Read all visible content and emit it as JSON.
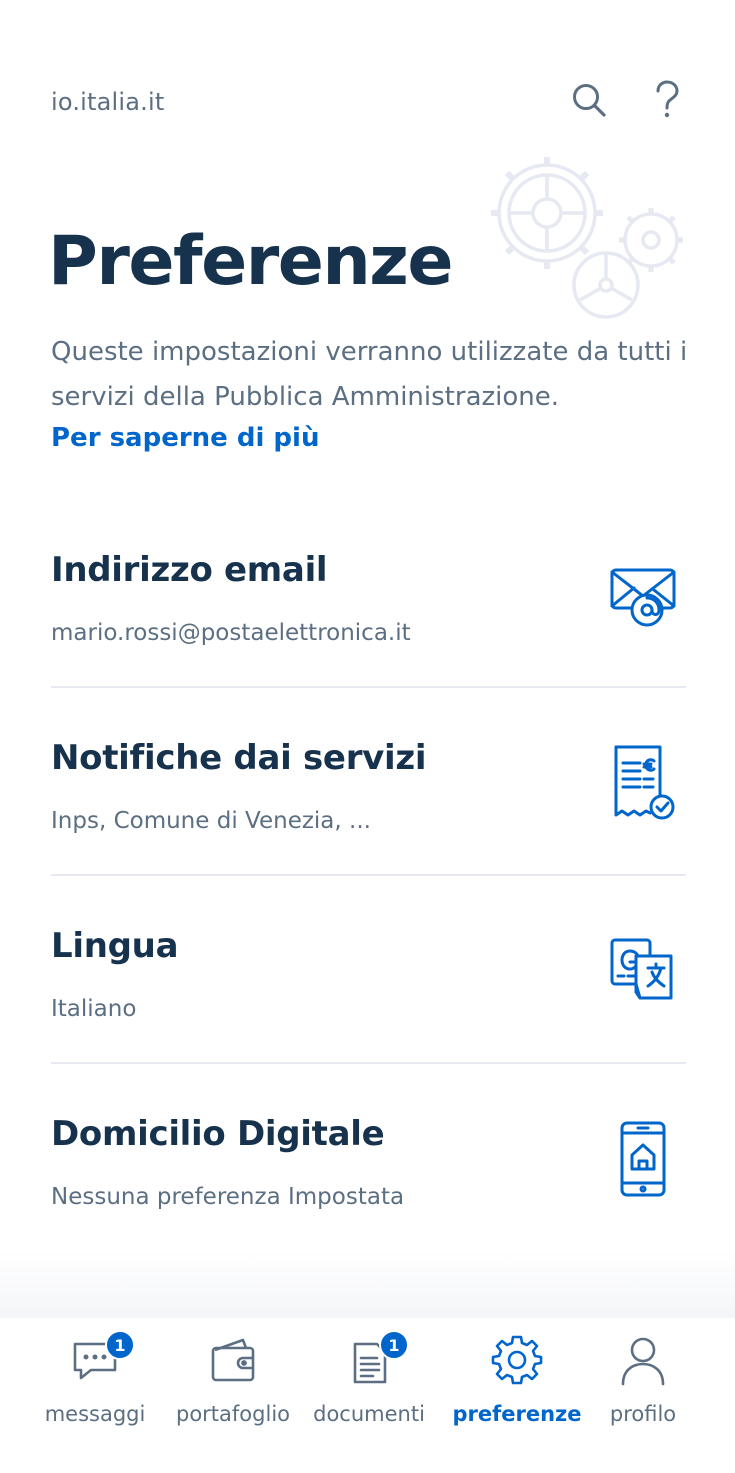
{
  "header": {
    "brand": "io.italia.it",
    "search_icon": "search-icon",
    "help_icon": "help-icon"
  },
  "page": {
    "title": "Preferenze",
    "subtitle": "Queste impostazioni verranno utilizzate da tutti i servizi della Pubblica Amministrazione.",
    "learn_more": "Per saperne di più"
  },
  "preferences": [
    {
      "title": "Indirizzo email",
      "value": "mario.rossi@postaelettronica.it",
      "icon": "email-icon"
    },
    {
      "title": "Notifiche dai servizi",
      "value": "Inps, Comune di Venezia, ...",
      "icon": "receipt-check-icon"
    },
    {
      "title": "Lingua",
      "value": "Italiano",
      "icon": "translate-icon"
    },
    {
      "title": "Domicilio Digitale",
      "value": "Nessuna preferenza Impostata",
      "icon": "smartphone-home-icon"
    }
  ],
  "tabs": [
    {
      "label": "messaggi",
      "icon": "messages-icon",
      "badge": "1",
      "active": false
    },
    {
      "label": "portafoglio",
      "icon": "wallet-icon",
      "badge": "",
      "active": false
    },
    {
      "label": "documenti",
      "icon": "documents-icon",
      "badge": "1",
      "active": false
    },
    {
      "label": "preferenze",
      "icon": "gear-icon",
      "badge": "",
      "active": true
    },
    {
      "label": "profilo",
      "icon": "profile-icon",
      "badge": "",
      "active": false
    }
  ],
  "colors": {
    "primary_text": "#17324d",
    "secondary_text": "#5c6f82",
    "accent": "#0066cc",
    "divider": "#e6e9f2"
  }
}
